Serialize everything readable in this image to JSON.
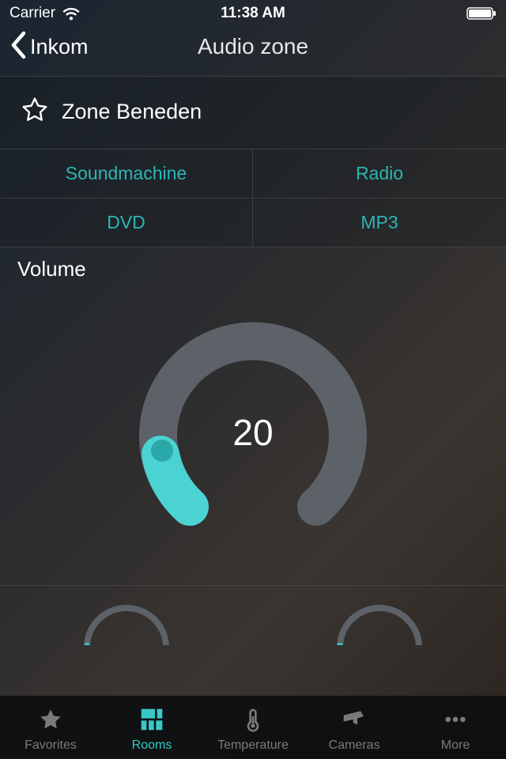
{
  "status": {
    "carrier": "Carrier",
    "time": "11:38 AM"
  },
  "nav": {
    "back_label": "Inkom",
    "title": "Audio zone"
  },
  "zone": {
    "name": "Zone Beneden"
  },
  "sources": [
    {
      "label": "Soundmachine"
    },
    {
      "label": "Radio"
    },
    {
      "label": "DVD"
    },
    {
      "label": "MP3"
    }
  ],
  "volume": {
    "label": "Volume",
    "value": "20",
    "percent": 20
  },
  "tabs": [
    {
      "label": "Favorites"
    },
    {
      "label": "Rooms"
    },
    {
      "label": "Temperature"
    },
    {
      "label": "Cameras"
    },
    {
      "label": "More"
    }
  ],
  "colors": {
    "accent": "#35c9c9",
    "source_text": "#2db5b5",
    "inactive": "#7a7a7a",
    "track": "#5c6268"
  }
}
